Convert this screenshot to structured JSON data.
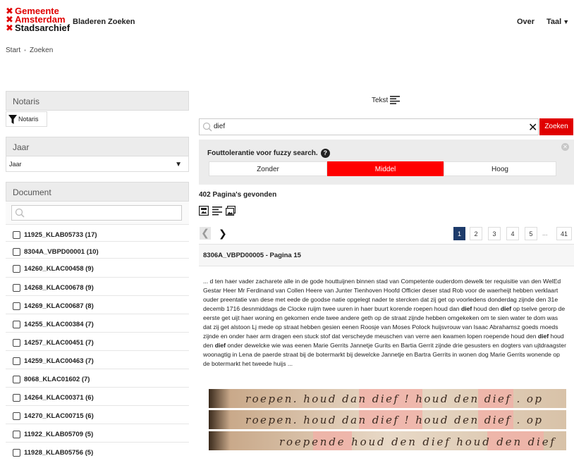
{
  "header": {
    "logo_lines": [
      "Gemeente",
      "Amsterdam",
      "Stadsarchief"
    ],
    "logo_mark": "✖",
    "nav": {
      "bladeren": "Bladeren",
      "zoeken": "Zoeken",
      "over": "Over",
      "taal": "Taal"
    }
  },
  "breadcrumb": {
    "start": "Start",
    "separator": "•",
    "current": "Zoeken"
  },
  "sidebar": {
    "notaris": {
      "title": "Notaris",
      "chip": "Notaris"
    },
    "jaar": {
      "title": "Jaar",
      "selected": "Jaar"
    },
    "document": {
      "title": "Document",
      "search_placeholder": "",
      "items": [
        "11925_KLAB05733 (17)",
        "8304A_VBPD00001 (10)",
        "14260_KLAC00458 (9)",
        "14268_KLAC00678 (9)",
        "14269_KLAC00687 (8)",
        "14255_KLAC00384 (7)",
        "14257_KLAC00451 (7)",
        "14259_KLAC00463 (7)",
        "8068_KLAC01602 (7)",
        "14264_KLAC00371 (6)",
        "14270_KLAC00715 (6)",
        "11922_KLAB05709 (5)",
        "11928_KLAB05756 (5)"
      ]
    }
  },
  "main": {
    "view_toggle": "Tekst",
    "search": {
      "value": "dief",
      "button": "Zoeken"
    },
    "fuzzy": {
      "title": "Fouttolerantie voor fuzzy search.",
      "help": "?",
      "options": [
        "Zonder",
        "Middel",
        "Hoog"
      ],
      "selected": "Middel"
    },
    "result_count": "402 Pagina's gevonden",
    "pagination": {
      "pages": [
        "1",
        "2",
        "3",
        "4",
        "5"
      ],
      "ellipsis": "...",
      "last": "41",
      "active": "1"
    },
    "result": {
      "title": "8306A_VBPD00005 - Pagina 15",
      "snippet": [
        {
          "t": "... d ten haer vader zacharete alle in de gode houttuijnen binnen stad van Competente ouderdom dewelk ter requisitie van den WelEd Gestar Heer Mr Ferdinand van Collen Heere van Junter Tienhoven Hoofd Officier deser stad Rob voor de waerheijt hebben verklaart ouder preentatie van dese met eede de goodse natie opgelegt nader te stercken dat zij get op voorledens donderdag zijnde den 31e decemb 1716 desnmiddags de Clocke ruijm twee uuren in haer buurt korende roepen houd dan "
        },
        {
          "b": "dief"
        },
        {
          "t": " houd den "
        },
        {
          "b": "dief"
        },
        {
          "t": " op tselve gerorp de eerste get uijt haer woning en gekomen ende twee andere geth op de straat zijnde hebben omgekeken om te sien water te dom was dat zij get alstoon Lj mede op straat hebben gesien eenen Roosje van Moses Polock huijsvrouw van Isaac Abrahamsz goeds moeds zijnde en onder haer arm dragen een stuck stof dat verscheyde meuschen van verre aen kwamen lopen roepende houd den "
        },
        {
          "b": "dief"
        },
        {
          "t": " houd den "
        },
        {
          "b": "dief"
        },
        {
          "t": " onder dewelcke wie was eenen Marie Gerrits Jannetje Gurits en Bartia Gerrit zijnde drie gesusters en dogters van ujtdraagster woonagtig in Lena de paerde straat bij de botermarkt bij dewelcke Jannetje en Bartra Gerrits in wonen dog Marie Gerrits wonende op de botermarkt het tweede huijs ..."
        }
      ]
    },
    "scan_lines": [
      {
        "text": "roepen. houd dan dief ! houd den dief . op"
      },
      {
        "text": "roepen. houd dan dief ! houd den dief . op"
      },
      {
        "text": "roepende houd den dief houd den dief"
      }
    ]
  },
  "colors": {
    "brand_red": "#e00000",
    "active_page": "#1d3b6b",
    "fuzzy_selected": "#ff0000"
  }
}
